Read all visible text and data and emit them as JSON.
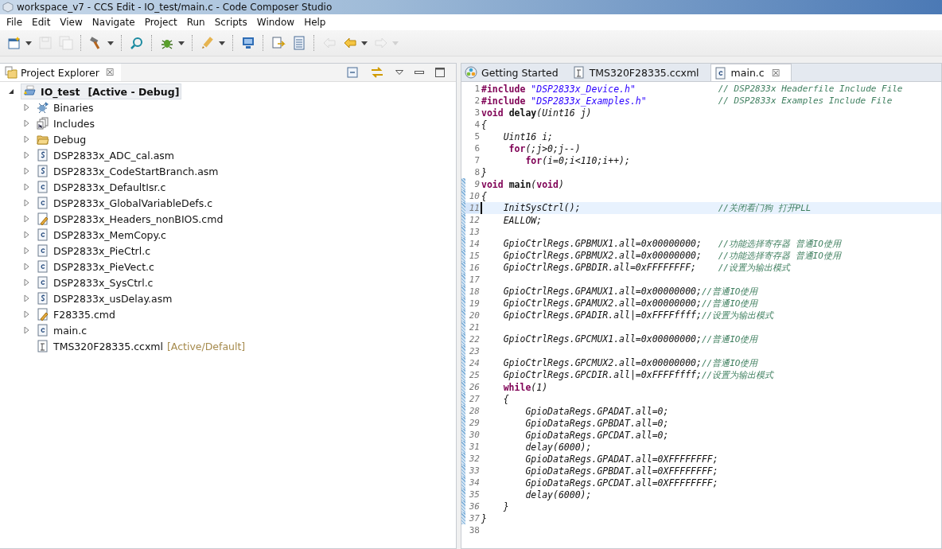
{
  "window": {
    "title": "workspace_v7 - CCS Edit - IO_test/main.c - Code Composer Studio"
  },
  "menu": [
    "File",
    "Edit",
    "View",
    "Navigate",
    "Project",
    "Run",
    "Scripts",
    "Window",
    "Help"
  ],
  "toolbar": [
    {
      "kind": "new",
      "disabled": false,
      "dropdown": true
    },
    {
      "kind": "save",
      "disabled": true,
      "dropdown": false
    },
    {
      "kind": "save-all",
      "disabled": true,
      "dropdown": false
    },
    {
      "kind": "build",
      "disabled": false,
      "dropdown": true
    },
    {
      "kind": "search",
      "disabled": false,
      "dropdown": false
    },
    {
      "kind": "debug",
      "disabled": false,
      "dropdown": true
    },
    {
      "kind": "flash",
      "disabled": false,
      "dropdown": true
    },
    {
      "kind": "monitor",
      "disabled": false,
      "dropdown": false
    },
    {
      "kind": "doc",
      "disabled": false,
      "dropdown": false
    },
    {
      "kind": "list",
      "disabled": false,
      "dropdown": false
    },
    {
      "kind": "back-edit",
      "disabled": true,
      "dropdown": false
    },
    {
      "kind": "back",
      "disabled": false,
      "dropdown": true
    },
    {
      "kind": "forward",
      "disabled": true,
      "dropdown": true
    }
  ],
  "explorer": {
    "title": "Project Explorer",
    "close": "☒",
    "project": {
      "name": "IO_test",
      "decoration": "[Active - Debug]",
      "expanded": true,
      "children": [
        {
          "label": "Binaries",
          "kind": "binaries",
          "expandable": true
        },
        {
          "label": "Includes",
          "kind": "includes",
          "expandable": true
        },
        {
          "label": "Debug",
          "kind": "folder",
          "expandable": true
        },
        {
          "label": "DSP2833x_ADC_cal.asm",
          "kind": "asm",
          "expandable": true
        },
        {
          "label": "DSP2833x_CodeStartBranch.asm",
          "kind": "asm",
          "expandable": true
        },
        {
          "label": "DSP2833x_DefaultIsr.c",
          "kind": "c",
          "expandable": true
        },
        {
          "label": "DSP2833x_GlobalVariableDefs.c",
          "kind": "c",
          "expandable": true
        },
        {
          "label": "DSP2833x_Headers_nonBIOS.cmd",
          "kind": "cmd",
          "expandable": true
        },
        {
          "label": "DSP2833x_MemCopy.c",
          "kind": "c",
          "expandable": true
        },
        {
          "label": "DSP2833x_PieCtrl.c",
          "kind": "c",
          "expandable": true
        },
        {
          "label": "DSP2833x_PieVect.c",
          "kind": "c",
          "expandable": true
        },
        {
          "label": "DSP2833x_SysCtrl.c",
          "kind": "c",
          "expandable": true
        },
        {
          "label": "DSP2833x_usDelay.asm",
          "kind": "asm",
          "expandable": true
        },
        {
          "label": "F28335.cmd",
          "kind": "cmd",
          "expandable": true
        },
        {
          "label": "main.c",
          "kind": "c",
          "expandable": true
        },
        {
          "label": "TMS320F28335.ccxml",
          "kind": "ccxml",
          "expandable": false,
          "decoration": "[Active/Default]"
        }
      ]
    }
  },
  "editor": {
    "tabs": [
      {
        "label": "Getting Started",
        "kind": "start",
        "selected": false
      },
      {
        "label": "TMS320F28335.ccxml",
        "kind": "ccxml",
        "selected": false
      },
      {
        "label": "main.c",
        "kind": "c",
        "selected": true,
        "close": "☒"
      }
    ],
    "lines": [
      {
        "number": "1",
        "changed": false,
        "current": false,
        "tokens": [
          {
            "kind": "keyword",
            "text": "#include"
          },
          {
            "kind": "string",
            "text": " \"DSP2833x_Device.h\""
          },
          {
            "kind": "aligned-comment",
            "text": "// DSP2833x Headerfile Include File"
          }
        ]
      },
      {
        "number": "2",
        "changed": false,
        "current": false,
        "tokens": [
          {
            "kind": "keyword",
            "text": "#include"
          },
          {
            "kind": "string",
            "text": " \"DSP2833x_Examples.h\""
          },
          {
            "kind": "aligned-comment",
            "text": "// DSP2833x Examples Include File"
          }
        ]
      },
      {
        "number": "3",
        "changed": false,
        "current": false,
        "tokens": [
          {
            "kind": "keyword",
            "text": "void"
          },
          {
            "kind": "decl",
            "text": " delay"
          },
          {
            "kind": "plain",
            "text": "(Uint16 j)"
          }
        ]
      },
      {
        "number": "4",
        "changed": false,
        "current": false,
        "tokens": [
          {
            "kind": "plain",
            "text": "{"
          }
        ]
      },
      {
        "number": "5",
        "changed": false,
        "current": false,
        "tokens": [
          {
            "kind": "plain",
            "text": "    Uint16 i;"
          }
        ]
      },
      {
        "number": "6",
        "changed": false,
        "current": false,
        "tokens": [
          {
            "kind": "keyword",
            "text": "     for"
          },
          {
            "kind": "plain",
            "text": "(;j>0;j--)"
          }
        ]
      },
      {
        "number": "7",
        "changed": false,
        "current": false,
        "tokens": [
          {
            "kind": "keyword",
            "text": "        for"
          },
          {
            "kind": "plain",
            "text": "(i=0;i<110;i++);"
          }
        ]
      },
      {
        "number": "8",
        "changed": false,
        "current": false,
        "tokens": [
          {
            "kind": "plain",
            "text": "}"
          }
        ]
      },
      {
        "number": "9",
        "changed": true,
        "current": false,
        "tokens": [
          {
            "kind": "keyword",
            "text": "void"
          },
          {
            "kind": "decl",
            "text": " main"
          },
          {
            "kind": "plain",
            "text": "("
          },
          {
            "kind": "keyword",
            "text": "void"
          },
          {
            "kind": "plain",
            "text": ")"
          }
        ]
      },
      {
        "number": "10",
        "changed": true,
        "current": false,
        "tokens": [
          {
            "kind": "plain",
            "text": "{"
          }
        ]
      },
      {
        "number": "11",
        "changed": true,
        "current": true,
        "tokens": [
          {
            "kind": "plain",
            "text": "    InitSysCtrl();"
          },
          {
            "kind": "aligned-comment",
            "text": "//关闭看门狗 打开PLL"
          }
        ]
      },
      {
        "number": "12",
        "changed": true,
        "current": false,
        "tokens": [
          {
            "kind": "plain",
            "text": "    EALLOW;"
          }
        ]
      },
      {
        "number": "13",
        "changed": true,
        "current": false
      },
      {
        "number": "14",
        "changed": true,
        "current": false,
        "tokens": [
          {
            "kind": "plain",
            "text": "    GpioCtrlRegs.GPBMUX1.all=0x00000000;"
          },
          {
            "kind": "aligned-comment",
            "text": "//功能选择寄存器 普通IO使用"
          }
        ]
      },
      {
        "number": "15",
        "changed": true,
        "current": false,
        "tokens": [
          {
            "kind": "plain",
            "text": "    GpioCtrlRegs.GPBMUX2.all=0x00000000;"
          },
          {
            "kind": "aligned-comment",
            "text": "//功能选择寄存器 普通IO使用"
          }
        ]
      },
      {
        "number": "16",
        "changed": true,
        "current": false,
        "tokens": [
          {
            "kind": "plain",
            "text": "    GpioCtrlRegs.GPBDIR.all=0xFFFFFFFF;"
          },
          {
            "kind": "aligned-comment",
            "text": "//设置为输出模式"
          }
        ]
      },
      {
        "number": "17",
        "changed": true,
        "current": false
      },
      {
        "number": "18",
        "changed": true,
        "current": false,
        "tokens": [
          {
            "kind": "plain",
            "text": "    GpioCtrlRegs.GPAMUX1.all=0x00000000;"
          },
          {
            "kind": "comment",
            "text": "//普通IO使用"
          }
        ]
      },
      {
        "number": "19",
        "changed": true,
        "current": false,
        "tokens": [
          {
            "kind": "plain",
            "text": "    GpioCtrlRegs.GPAMUX2.all=0x00000000;"
          },
          {
            "kind": "comment",
            "text": "//普通IO使用"
          }
        ]
      },
      {
        "number": "20",
        "changed": true,
        "current": false,
        "tokens": [
          {
            "kind": "plain",
            "text": "    GpioCtrlRegs.GPADIR.all|=0xFFFFffff;"
          },
          {
            "kind": "comment",
            "text": "//设置为输出模式"
          }
        ]
      },
      {
        "number": "21",
        "changed": true,
        "current": false
      },
      {
        "number": "22",
        "changed": true,
        "current": false,
        "tokens": [
          {
            "kind": "plain",
            "text": "    GpioCtrlRegs.GPCMUX1.all=0x00000000;"
          },
          {
            "kind": "comment",
            "text": "//普通IO使用"
          }
        ]
      },
      {
        "number": "23",
        "changed": true,
        "current": false
      },
      {
        "number": "24",
        "changed": true,
        "current": false,
        "tokens": [
          {
            "kind": "plain",
            "text": "    GpioCtrlRegs.GPCMUX2.all=0x00000000;"
          },
          {
            "kind": "comment",
            "text": "//普通IO使用"
          }
        ]
      },
      {
        "number": "25",
        "changed": true,
        "current": false,
        "tokens": [
          {
            "kind": "plain",
            "text": "    GpioCtrlRegs.GPCDIR.all|=0xFFFFffff;"
          },
          {
            "kind": "comment",
            "text": "//设置为输出模式"
          }
        ]
      },
      {
        "number": "26",
        "changed": true,
        "current": false,
        "tokens": [
          {
            "kind": "keyword",
            "text": "    while"
          },
          {
            "kind": "plain",
            "text": "(1)"
          }
        ]
      },
      {
        "number": "27",
        "changed": true,
        "current": false,
        "tokens": [
          {
            "kind": "plain",
            "text": "    {"
          }
        ]
      },
      {
        "number": "28",
        "changed": true,
        "current": false,
        "tokens": [
          {
            "kind": "plain",
            "text": "        GpioDataRegs.GPADAT.all=0;"
          }
        ]
      },
      {
        "number": "29",
        "changed": true,
        "current": false,
        "tokens": [
          {
            "kind": "plain",
            "text": "        GpioDataRegs.GPBDAT.all=0;"
          }
        ]
      },
      {
        "number": "30",
        "changed": true,
        "current": false,
        "tokens": [
          {
            "kind": "plain",
            "text": "        GpioDataRegs.GPCDAT.all=0;"
          }
        ]
      },
      {
        "number": "31",
        "changed": true,
        "current": false,
        "tokens": [
          {
            "kind": "plain",
            "text": "        delay(6000);"
          }
        ]
      },
      {
        "number": "32",
        "changed": true,
        "current": false,
        "tokens": [
          {
            "kind": "plain",
            "text": "        GpioDataRegs.GPADAT.all=0XFFFFFFFF;"
          }
        ]
      },
      {
        "number": "33",
        "changed": true,
        "current": false,
        "tokens": [
          {
            "kind": "plain",
            "text": "        GpioDataRegs.GPBDAT.all=0XFFFFFFFF;"
          }
        ]
      },
      {
        "number": "34",
        "changed": true,
        "current": false,
        "tokens": [
          {
            "kind": "plain",
            "text": "        GpioDataRegs.GPCDAT.all=0XFFFFFFFF;"
          }
        ]
      },
      {
        "number": "35",
        "changed": true,
        "current": false,
        "tokens": [
          {
            "kind": "plain",
            "text": "        delay(6000);"
          }
        ]
      },
      {
        "number": "36",
        "changed": true,
        "current": false,
        "tokens": [
          {
            "kind": "plain",
            "text": "    }"
          }
        ]
      },
      {
        "number": "37",
        "changed": true,
        "current": false,
        "tokens": [
          {
            "kind": "plain",
            "text": "}"
          }
        ]
      },
      {
        "number": "38",
        "changed": false,
        "current": false
      }
    ]
  }
}
